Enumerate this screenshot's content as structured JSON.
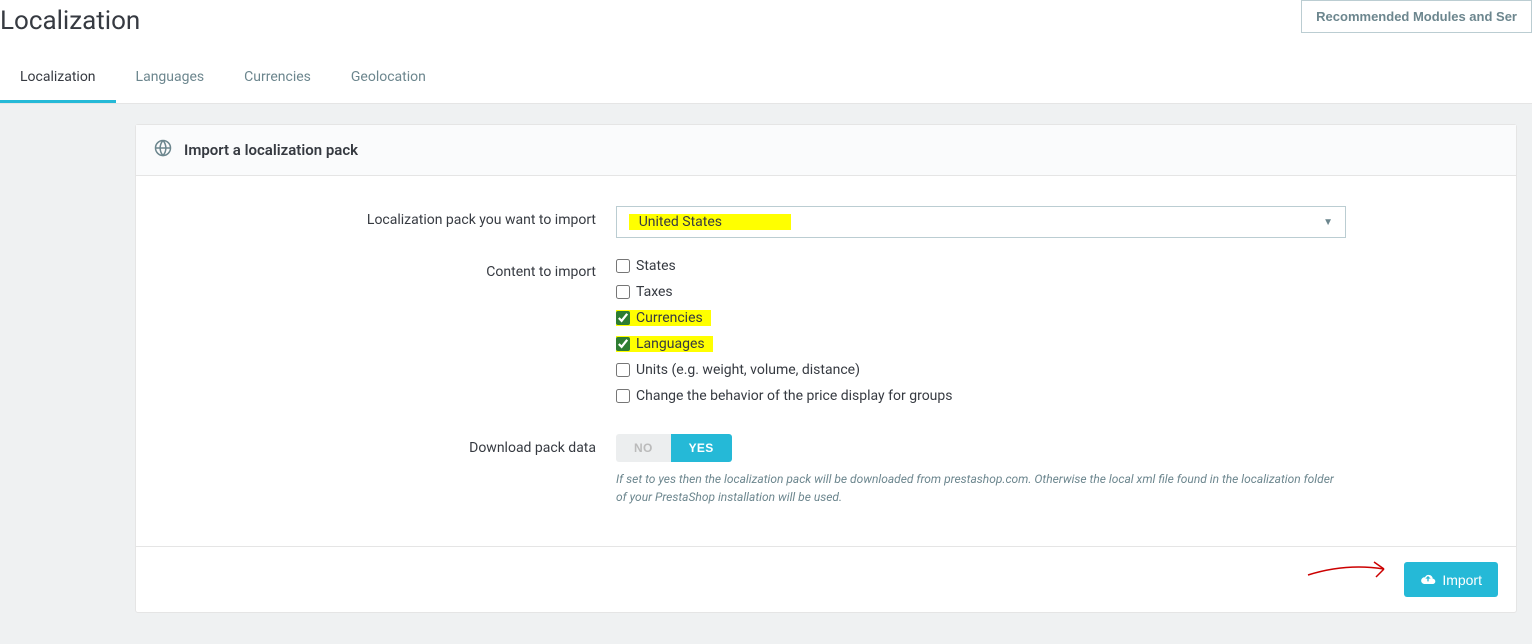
{
  "header": {
    "title": "Localization",
    "recommended_btn": "Recommended Modules and Ser"
  },
  "tabs": [
    {
      "label": "Localization",
      "active": true
    },
    {
      "label": "Languages",
      "active": false
    },
    {
      "label": "Currencies",
      "active": false
    },
    {
      "label": "Geolocation",
      "active": false
    }
  ],
  "panel": {
    "title": "Import a localization pack",
    "fields": {
      "pack_label": "Localization pack you want to import",
      "pack_value": "United States",
      "content_label": "Content to import",
      "content_options": [
        {
          "label": "States",
          "checked": false,
          "highlight": false
        },
        {
          "label": "Taxes",
          "checked": false,
          "highlight": false
        },
        {
          "label": "Currencies",
          "checked": true,
          "highlight": true
        },
        {
          "label": "Languages",
          "checked": true,
          "highlight": true
        },
        {
          "label": "Units (e.g. weight, volume, distance)",
          "checked": false,
          "highlight": false
        },
        {
          "label": "Change the behavior of the price display for groups",
          "checked": false,
          "highlight": false
        }
      ],
      "download_label": "Download pack data",
      "toggle_no": "NO",
      "toggle_yes": "YES",
      "download_help": "If set to yes then the localization pack will be downloaded from prestashop.com. Otherwise the local xml file found in the localization folder of your PrestaShop installation will be used."
    },
    "footer": {
      "import_btn": "Import"
    }
  }
}
